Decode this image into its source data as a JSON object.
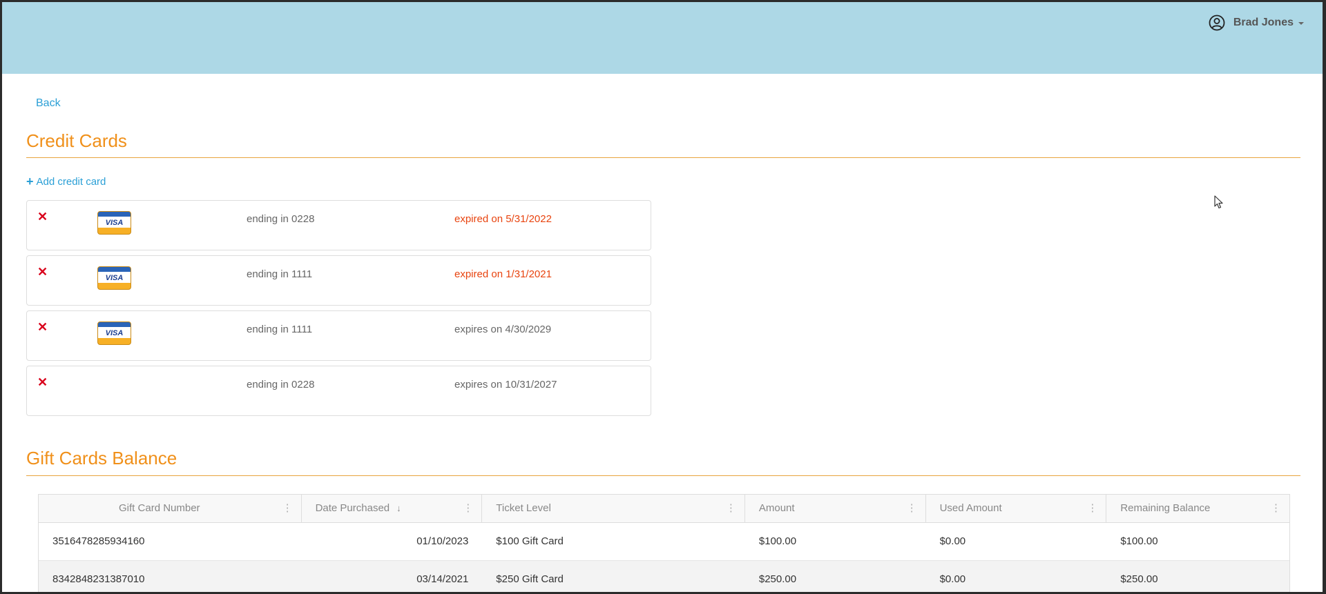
{
  "header": {
    "user_name": "Brad Jones"
  },
  "nav": {
    "back_label": "Back"
  },
  "credit_cards": {
    "title": "Credit Cards",
    "add_label": "Add credit card",
    "add_icon": "+",
    "remove_icon": "✕",
    "cards": [
      {
        "brand": "VISA",
        "ending": "ending in 0228",
        "expiry": "expired on 5/31/2022",
        "expired": true
      },
      {
        "brand": "VISA",
        "ending": "ending in 1111",
        "expiry": "expired on 1/31/2021",
        "expired": true
      },
      {
        "brand": "VISA",
        "ending": "ending in 1111",
        "expiry": "expires on 4/30/2029",
        "expired": false
      },
      {
        "brand": "",
        "ending": "ending in 0228",
        "expiry": "expires on 10/31/2027",
        "expired": false
      }
    ]
  },
  "gift_cards": {
    "title": "Gift Cards Balance",
    "columns": [
      "Gift Card Number",
      "Date Purchased",
      "Ticket Level",
      "Amount",
      "Used Amount",
      "Remaining Balance"
    ],
    "sort_icon": "↓",
    "menu_icon": "⋮",
    "rows": [
      [
        "3516478285934160",
        "01/10/2023",
        "$100 Gift Card",
        "$100.00",
        "$0.00",
        "$100.00"
      ],
      [
        "8342848231387010",
        "03/14/2021",
        "$250 Gift Card",
        "$250.00",
        "$0.00",
        "$250.00"
      ]
    ]
  },
  "colors": {
    "header_bg": "#add8e6",
    "accent_orange": "#f0901a",
    "link_blue": "#2a9fd6",
    "expired_red": "#e8430e",
    "remove_red": "#d9001b"
  }
}
